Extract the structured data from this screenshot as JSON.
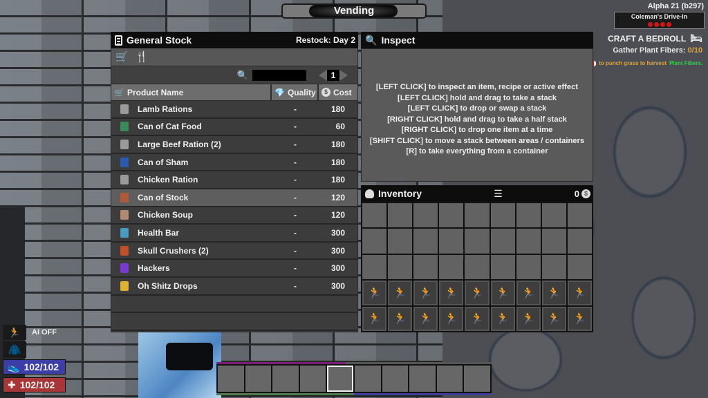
{
  "window": {
    "title": "Vending"
  },
  "hud_top_right": {
    "version": "Alpha 21 (b297)",
    "location": "Coleman's Drive-In",
    "danger_level": 4,
    "quest_title": "CRAFT A BEDROLL",
    "quest_task_label": "Gather Plant Fibers:",
    "quest_task_progress": "0/10",
    "quest_hint_prefix": "to punch grass to harvest",
    "quest_hint_highlight": "Plant Fibers."
  },
  "stock": {
    "title": "General Stock",
    "restock": "Restock: Day 2",
    "search_placeholder": "",
    "page": "1",
    "columns": {
      "name": "Product Name",
      "quality": "Quality",
      "cost": "Cost"
    },
    "items": [
      {
        "name": "Lamb Rations",
        "quality": "-",
        "cost": "180",
        "icon_color": "#9a9a9a",
        "selected": false
      },
      {
        "name": "Can of Cat Food",
        "quality": "-",
        "cost": "60",
        "icon_color": "#3c8a5a",
        "selected": false
      },
      {
        "name": "Large Beef Ration (2)",
        "quality": "-",
        "cost": "180",
        "icon_color": "#9a9a9a",
        "selected": false
      },
      {
        "name": "Can of Sham",
        "quality": "-",
        "cost": "180",
        "icon_color": "#2a5ab0",
        "selected": false
      },
      {
        "name": "Chicken Ration",
        "quality": "-",
        "cost": "180",
        "icon_color": "#9a9a9a",
        "selected": false
      },
      {
        "name": "Can of Stock",
        "quality": "-",
        "cost": "120",
        "icon_color": "#b0583a",
        "selected": true
      },
      {
        "name": "Chicken Soup",
        "quality": "-",
        "cost": "120",
        "icon_color": "#b08a70",
        "selected": false
      },
      {
        "name": "Health Bar",
        "quality": "-",
        "cost": "300",
        "icon_color": "#4a9ac0",
        "selected": false
      },
      {
        "name": "Skull Crushers (2)",
        "quality": "-",
        "cost": "300",
        "icon_color": "#c0502a",
        "selected": false
      },
      {
        "name": "Hackers",
        "quality": "-",
        "cost": "300",
        "icon_color": "#7a3ad0",
        "selected": false
      },
      {
        "name": "Oh Shitz Drops",
        "quality": "-",
        "cost": "300",
        "icon_color": "#e0b030",
        "selected": false
      }
    ]
  },
  "inspect": {
    "title": "Inspect",
    "lines": [
      "[LEFT CLICK] to inspect an item, recipe or active effect",
      "[LEFT CLICK] hold and drag to take a stack",
      "[LEFT CLICK] to drop or swap a stack",
      "[RIGHT CLICK] hold and drag to take a half stack",
      "[RIGHT CLICK] to drop one item at a time",
      "[SHIFT CLICK] to move a stack between areas / containers",
      "[R] to take everything from a container"
    ]
  },
  "inventory": {
    "title": "Inventory",
    "coins": "0",
    "unlocked_rows": 3,
    "locked_rows": 2,
    "columns": 9
  },
  "hud_bottom_left": {
    "ai_status": "AI OFF",
    "stamina": "102/102",
    "health": "102/102"
  },
  "toolbelt": {
    "slot_count": 10,
    "active_slot": 5
  }
}
